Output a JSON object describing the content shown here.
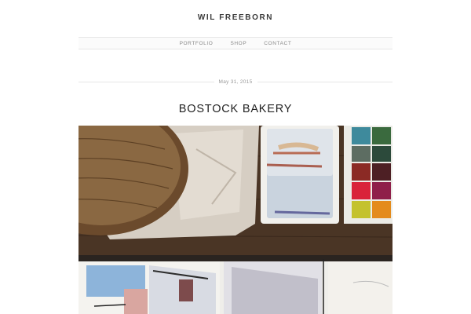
{
  "site": {
    "title": "WIL FREEBORN"
  },
  "nav": {
    "items": [
      {
        "label": "PORTFOLIO"
      },
      {
        "label": "SHOP"
      },
      {
        "label": "CONTACT"
      }
    ]
  },
  "post": {
    "date": "May 31, 2015",
    "title": "BOSTOCK BAKERY"
  }
}
